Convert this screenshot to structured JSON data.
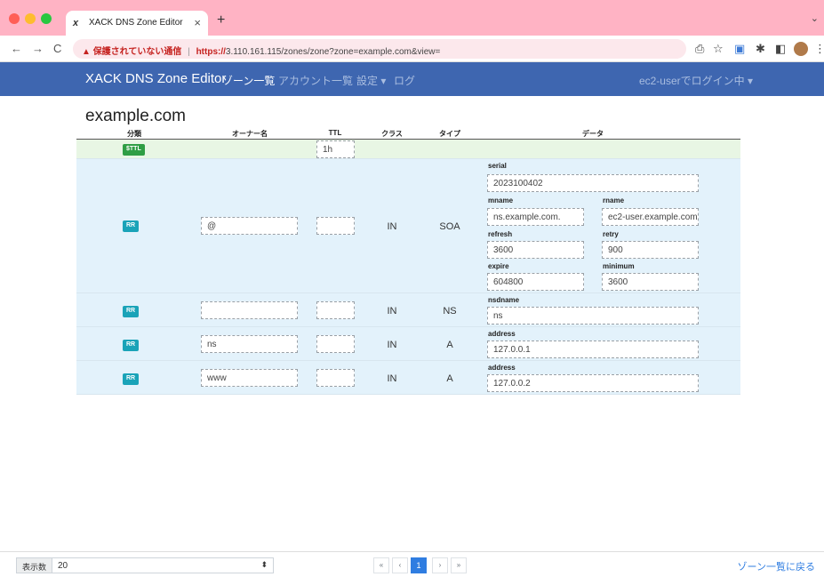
{
  "browser": {
    "tab_title": "XACK DNS Zone Editor",
    "tab_favicon": "x",
    "warning_text": "保護されていない通信",
    "url_scheme": "https://",
    "url_rest": "3.110.161.115/zones/zone?zone=example.com&view="
  },
  "navbar": {
    "brand": "XACK DNS Zone Editor",
    "links": [
      "ゾーン一覧",
      "アカウント一覧",
      "設定 ▾",
      "ログ"
    ],
    "user": "ec2-userでログイン中 ▾"
  },
  "zone": {
    "title": "example.com",
    "headers": [
      "分類",
      "オーナー名",
      "TTL",
      "クラス",
      "タイプ",
      "データ"
    ],
    "ttl_row": {
      "badge": "$TTL",
      "ttl": "1h"
    },
    "records": [
      {
        "badge": "RR",
        "owner": "@",
        "ttl": "",
        "class": "IN",
        "type": "SOA",
        "fields": [
          {
            "label": "serial",
            "value": "2023100402"
          },
          {
            "label": "mname",
            "value": "ns.example.com."
          },
          {
            "label": "rname",
            "value": "ec2-user.example.com"
          },
          {
            "label": "refresh",
            "value": "3600"
          },
          {
            "label": "retry",
            "value": "900"
          },
          {
            "label": "expire",
            "value": "604800"
          },
          {
            "label": "minimum",
            "value": "3600"
          }
        ]
      },
      {
        "badge": "RR",
        "owner": "",
        "ttl": "",
        "class": "IN",
        "type": "NS",
        "fields": [
          {
            "label": "nsdname",
            "value": "ns"
          }
        ]
      },
      {
        "badge": "RR",
        "owner": "ns",
        "ttl": "",
        "class": "IN",
        "type": "A",
        "fields": [
          {
            "label": "address",
            "value": "127.0.0.1"
          }
        ]
      },
      {
        "badge": "RR",
        "owner": "www",
        "ttl": "",
        "class": "IN",
        "type": "A",
        "fields": [
          {
            "label": "address",
            "value": "127.0.0.2"
          }
        ]
      }
    ]
  },
  "footer": {
    "page_size_label": "表示数",
    "page_size_value": "20",
    "pager": [
      "«",
      "‹",
      "1",
      "›",
      "»"
    ],
    "back_link": "ゾーン一覧に戻る"
  },
  "colors": {
    "tabbar": "#ffb3c4",
    "navbar": "#3e66b0",
    "ttl_row": "#e8f6e4",
    "rr_row": "#e3f2fb",
    "badge_ttl": "#2f9e44",
    "badge_rr": "#1aa3b8",
    "link": "#2f7de1"
  }
}
